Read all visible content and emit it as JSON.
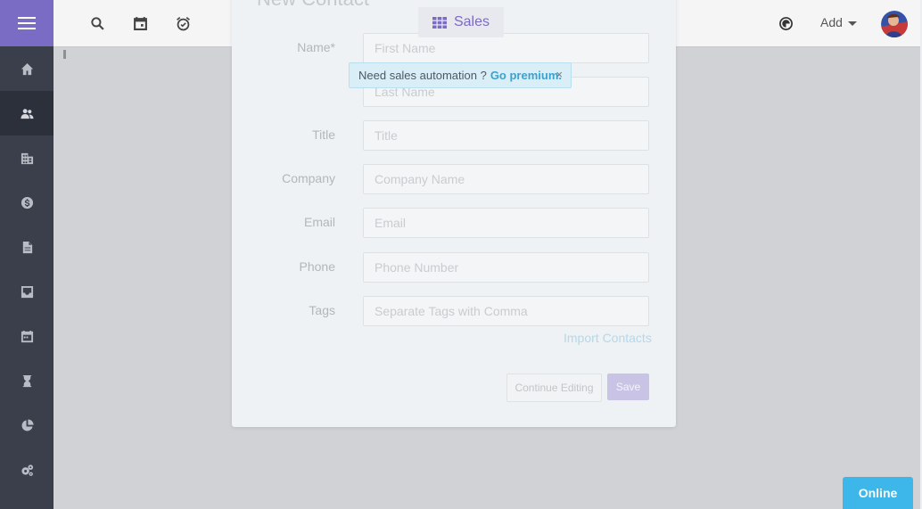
{
  "sidebar": {
    "items": [
      {
        "icon": "home-icon"
      },
      {
        "icon": "contacts-icon",
        "active": true
      },
      {
        "icon": "company-icon"
      },
      {
        "icon": "deals-icon"
      },
      {
        "icon": "document-icon"
      },
      {
        "icon": "inbox-icon"
      },
      {
        "icon": "calendar-icon"
      },
      {
        "icon": "timer-icon"
      },
      {
        "icon": "reports-icon"
      },
      {
        "icon": "settings-icon"
      }
    ]
  },
  "topbar": {
    "icons": [
      "search-icon",
      "calendar-icon",
      "alarm-icon"
    ],
    "add_label": "Add",
    "theme_icon": "contrast-icon"
  },
  "app_switcher": {
    "label": "Sales",
    "icon": "grid-icon"
  },
  "alert": {
    "text": "Need sales automation ?",
    "link": "Go premium.",
    "close": "×"
  },
  "modal": {
    "title": "New Contact",
    "fields": {
      "name_label": "Name*",
      "first_name_placeholder": "First Name",
      "last_name_placeholder": "Last Name",
      "title_label": "Title",
      "title_placeholder": "Title",
      "company_label": "Company",
      "company_placeholder": "Company Name",
      "email_label": "Email",
      "email_placeholder": "Email",
      "phone_label": "Phone",
      "phone_placeholder": "Phone Number",
      "tags_label": "Tags",
      "tags_placeholder": "Separate Tags with Comma"
    },
    "import_link": "Import Contacts",
    "continue_button": "Continue Editing",
    "save_button": "Save"
  },
  "status": {
    "online_label": "Online"
  },
  "colors": {
    "accent": "#7a6cc4",
    "sidebar": "#3a3f4b",
    "online": "#3db7ea"
  }
}
